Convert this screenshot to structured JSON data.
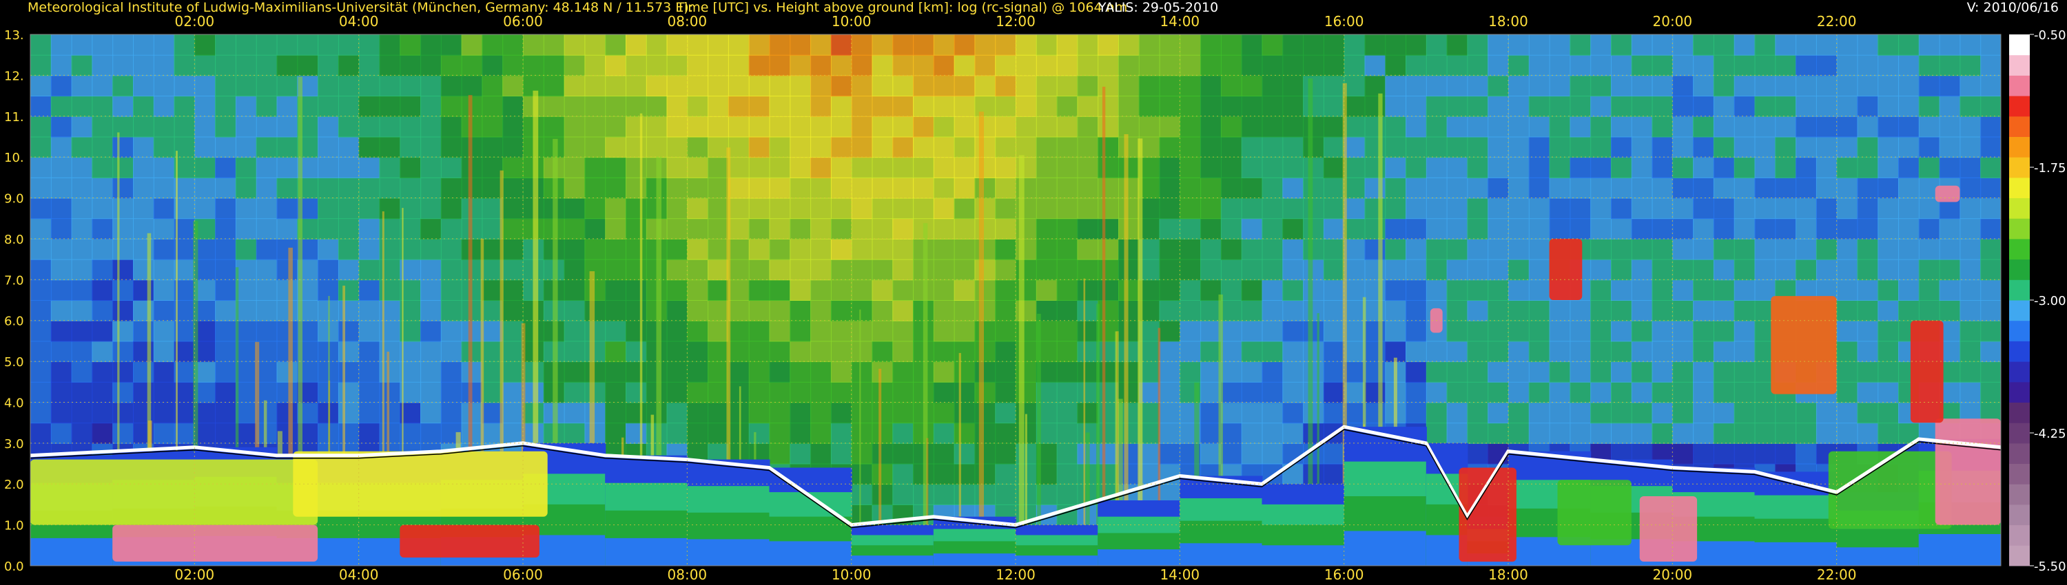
{
  "header": {
    "institution": "Meteorological Institute of Ludwig-Maximilians-Universität (München, Germany: 48.148 N / 11.573 E):",
    "axis_description": "Time [UTC] vs. Height above ground [km]: log (rc-signal) @ 1064 nm",
    "instrument_date": "YALIS: 29-05-2010",
    "version": "V: 2010/06/16"
  },
  "colors": {
    "text_yellow": "#ffe03c",
    "text_white": "#ffffff",
    "grid": "#d9c23a",
    "background": "#000000"
  },
  "chart_data": {
    "type": "heatmap",
    "x_axis": {
      "unit": "UTC",
      "range_hours": [
        0,
        24
      ],
      "tick_labels": [
        "02:00",
        "04:00",
        "06:00",
        "08:00",
        "10:00",
        "12:00",
        "14:00",
        "16:00",
        "18:00",
        "20:00",
        "22:00"
      ],
      "tick_hours": [
        2,
        4,
        6,
        8,
        10,
        12,
        14,
        16,
        18,
        20,
        22
      ]
    },
    "y_axis": {
      "unit": "km",
      "range": [
        0,
        13
      ],
      "tick_labels": [
        "0.0",
        "1.0",
        "2.0",
        "3.0",
        "4.0",
        "5.0",
        "6.0",
        "7.0",
        "8.0",
        "9.0",
        "10.",
        "11.",
        "12.",
        "13."
      ],
      "tick_values": [
        0,
        1,
        2,
        3,
        4,
        5,
        6,
        7,
        8,
        9,
        10,
        11,
        12,
        13
      ]
    },
    "colorbar": {
      "range": [
        -5.5,
        -0.5
      ],
      "tick_labels": [
        "-0.50",
        "-1.75",
        "-3.00",
        "-4.25",
        "-5.50"
      ],
      "tick_values": [
        -0.5,
        -1.75,
        -3.0,
        -4.25,
        -5.5
      ],
      "colors": [
        "#c2a0b8",
        "#b894b0",
        "#a886a4",
        "#9a7596",
        "#8a5f88",
        "#7a4d7e",
        "#6a3c76",
        "#5a2c70",
        "#3a1e9a",
        "#2c2cb8",
        "#2246dc",
        "#2878f0",
        "#40a8f0",
        "#2ac07a",
        "#22a83a",
        "#3ec02a",
        "#8ad62a",
        "#c8e82a",
        "#f0ee2a",
        "#f8c21e",
        "#f89a14",
        "#f4641a",
        "#ec2a1e",
        "#f07e9a",
        "#f6bed0",
        "#ffffff"
      ]
    },
    "grid": true,
    "layers": {
      "boundary_layer_top_km": [
        [
          0.0,
          2.7
        ],
        [
          1.0,
          2.8
        ],
        [
          2.0,
          2.9
        ],
        [
          3.0,
          2.7
        ],
        [
          4.0,
          2.7
        ],
        [
          5.0,
          2.8
        ],
        [
          6.0,
          3.0
        ],
        [
          7.0,
          2.7
        ],
        [
          8.0,
          2.6
        ],
        [
          9.0,
          2.4
        ],
        [
          10.0,
          1.0
        ],
        [
          11.0,
          1.2
        ],
        [
          12.0,
          1.0
        ],
        [
          13.0,
          1.6
        ],
        [
          14.0,
          2.2
        ],
        [
          15.0,
          2.0
        ],
        [
          16.0,
          3.4
        ],
        [
          17.0,
          3.0
        ],
        [
          17.5,
          1.2
        ],
        [
          18.0,
          2.8
        ],
        [
          19.0,
          2.6
        ],
        [
          20.0,
          2.4
        ],
        [
          21.0,
          2.3
        ],
        [
          22.0,
          1.8
        ],
        [
          23.0,
          3.1
        ],
        [
          24.0,
          2.9
        ]
      ],
      "cloud_patches": [
        {
          "t0": 1.0,
          "t1": 3.5,
          "h0": 0.1,
          "h1": 1.0,
          "v": -1.0
        },
        {
          "t0": 0.0,
          "t1": 3.5,
          "h0": 1.0,
          "h1": 2.6,
          "v": -2.1
        },
        {
          "t0": 3.2,
          "t1": 6.3,
          "h0": 1.2,
          "h1": 2.8,
          "v": -2.0
        },
        {
          "t0": 4.5,
          "t1": 6.2,
          "h0": 0.2,
          "h1": 1.0,
          "v": -1.2
        },
        {
          "t0": 17.4,
          "t1": 18.1,
          "h0": 0.1,
          "h1": 2.4,
          "v": -1.1
        },
        {
          "t0": 19.6,
          "t1": 20.3,
          "h0": 0.1,
          "h1": 1.7,
          "v": -1.0
        },
        {
          "t0": 18.6,
          "t1": 19.5,
          "h0": 0.5,
          "h1": 2.1,
          "v": -2.5
        },
        {
          "t0": 21.9,
          "t1": 23.4,
          "h0": 0.9,
          "h1": 2.8,
          "v": -2.6
        },
        {
          "t0": 23.2,
          "t1": 24.0,
          "h0": 1.0,
          "h1": 3.6,
          "v": -1.0
        },
        {
          "t0": 18.5,
          "t1": 18.9,
          "h0": 6.5,
          "h1": 8.0,
          "v": -1.1
        },
        {
          "t0": 21.2,
          "t1": 22.0,
          "h0": 4.2,
          "h1": 6.6,
          "v": -1.3
        },
        {
          "t0": 22.9,
          "t1": 23.3,
          "h0": 3.5,
          "h1": 6.0,
          "v": -1.2
        },
        {
          "t0": 23.2,
          "t1": 23.5,
          "h0": 8.9,
          "h1": 9.3,
          "v": -0.9
        },
        {
          "t0": 17.05,
          "t1": 17.2,
          "h0": 5.7,
          "h1": 6.3,
          "v": -1.0
        }
      ]
    }
  }
}
